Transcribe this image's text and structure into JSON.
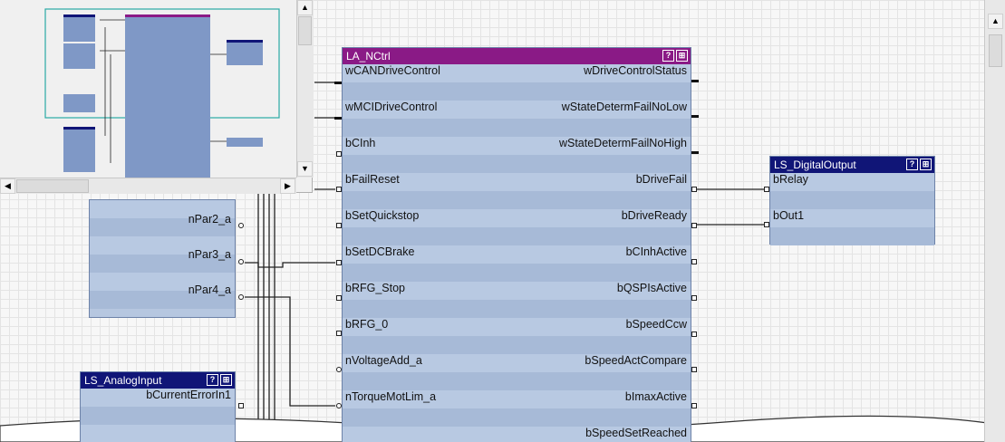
{
  "main_block": {
    "title": "LA_NCtrl",
    "help_icon": "?",
    "pin_icon": "grid",
    "inputs": [
      "wCANDriveControl",
      "wMCIDriveControl",
      "bCInh",
      "bFailReset",
      "bSetQuickstop",
      "bSetDCBrake",
      "bRFG_Stop",
      "bRFG_0",
      "nVoltageAdd_a",
      "nTorqueMotLim_a"
    ],
    "outputs": [
      "wDriveControlStatus",
      "wStateDetermFailNoLow",
      "wStateDetermFailNoHigh",
      "bDriveFail",
      "bDriveReady",
      "bCInhActive",
      "bQSPIsActive",
      "bSpeedCcw",
      "bSpeedActCompare",
      "bImaxActive",
      "bSpeedSetReached"
    ]
  },
  "digital_output_block": {
    "title": "LS_DigitalOutput",
    "inputs": [
      "bRelay",
      "bOut1"
    ]
  },
  "param_block": {
    "outputs": [
      "nPar2_a",
      "nPar3_a",
      "nPar4_a"
    ]
  },
  "analog_input_block": {
    "title": "LS_AnalogInput",
    "outputs": [
      "bCurrentErrorIn1"
    ]
  },
  "icons": {
    "help": "question-icon",
    "pin": "grid-icon",
    "scroll_up": "▲",
    "scroll_down": "▼",
    "scroll_left": "◀",
    "scroll_right": "▶"
  },
  "colors": {
    "main_title": "#8a1a86",
    "block_title": "#101577",
    "block_body": "#b6c7e0",
    "minimap_border": "#2aa9a5"
  }
}
